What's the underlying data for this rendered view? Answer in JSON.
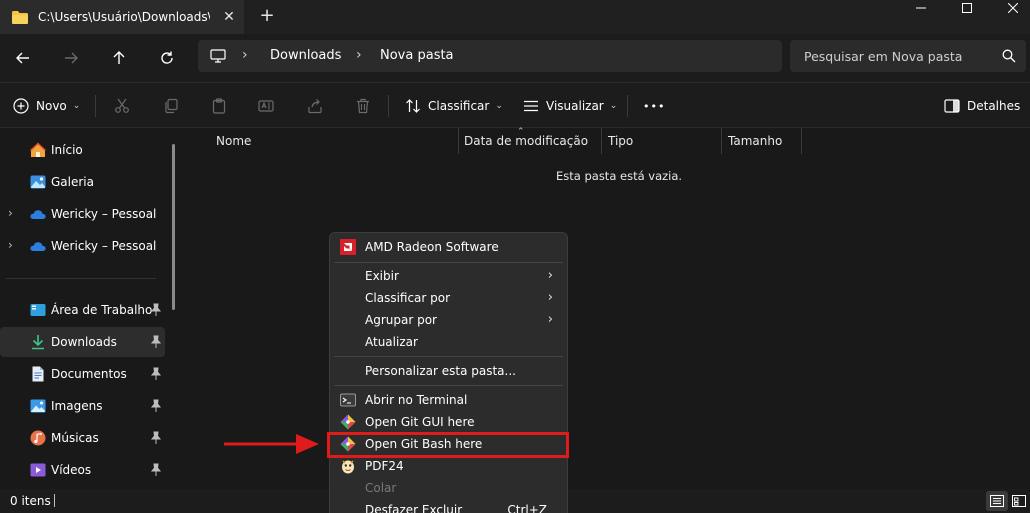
{
  "window": {
    "tab_title": "C:\\Users\\Usuário\\Downloads\\N",
    "new_tab_symbol": "+",
    "close_tab_symbol": "✕"
  },
  "address": {
    "crumbs": [
      "Downloads",
      "Nova pasta"
    ],
    "search_placeholder": "Pesquisar em Nova pasta"
  },
  "commandbar": {
    "new_label": "Novo",
    "sort_label": "Classificar",
    "view_label": "Visualizar",
    "more_label": "•••",
    "details_label": "Detalhes"
  },
  "sidebar": {
    "items": [
      {
        "label": "Início",
        "icon": "home-icon"
      },
      {
        "label": "Galeria",
        "icon": "gallery-icon"
      },
      {
        "label": "Wericky – Pessoal",
        "icon": "onedrive-cloud-icon"
      },
      {
        "label": "Wericky – Pessoal",
        "icon": "onedrive-cloud-icon"
      },
      {
        "label": "Área de Trabalho",
        "icon": "desktop-icon"
      },
      {
        "label": "Downloads",
        "icon": "download-icon"
      },
      {
        "label": "Documentos",
        "icon": "documents-icon"
      },
      {
        "label": "Imagens",
        "icon": "pictures-icon"
      },
      {
        "label": "Músicas",
        "icon": "music-icon"
      },
      {
        "label": "Vídeos",
        "icon": "videos-icon"
      }
    ]
  },
  "content": {
    "columns": [
      "Nome",
      "Data de modificação",
      "Tipo",
      "Tamanho"
    ],
    "empty_message": "Esta pasta está vazia."
  },
  "status": {
    "item_count": "0 itens"
  },
  "context_menu": {
    "items": [
      {
        "label": "AMD Radeon Software",
        "icon": "amd-radeon-icon"
      },
      {
        "label": "Exibir",
        "submenu": "›"
      },
      {
        "label": "Classificar por",
        "submenu": "›"
      },
      {
        "label": "Agrupar por",
        "submenu": "›"
      },
      {
        "label": "Atualizar"
      },
      {
        "label": "Personalizar esta pasta..."
      },
      {
        "label": "Abrir no Terminal",
        "icon": "terminal-icon"
      },
      {
        "label": "Open Git GUI here",
        "icon": "git-icon"
      },
      {
        "label": "Open Git Bash here",
        "icon": "git-icon"
      },
      {
        "label": "PDF24",
        "icon": "pdf24-icon"
      },
      {
        "label": "Colar",
        "disabled": true
      },
      {
        "label": "Desfazer Excluir",
        "shortcut": "Ctrl+Z"
      }
    ]
  },
  "colors": {
    "highlight": "#e01b1b",
    "accent_folder": "#f4c542"
  }
}
